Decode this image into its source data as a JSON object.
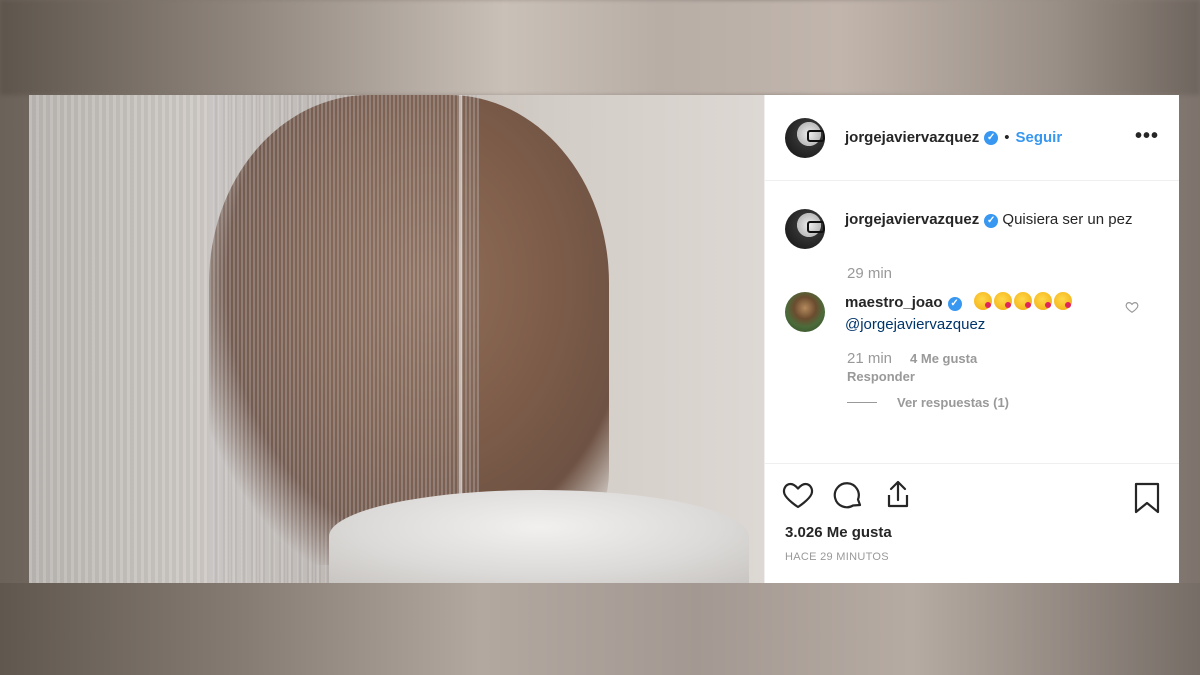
{
  "post": {
    "author": {
      "username": "jorgejavier vazquez",
      "display_username": "jorgejaviervazquez",
      "verified": true
    },
    "header": {
      "separator": "•",
      "follow_label": "Seguir",
      "more_label": "•••"
    },
    "caption": {
      "username": "jorgejaviervazquez",
      "text": "Quisiera ser un pez",
      "time": "29 min"
    },
    "comments": [
      {
        "username": "maestro_joao",
        "verified": true,
        "emoji_count": 5,
        "mention": "@jorgejaviervazquez",
        "time": "21 min",
        "likes": "4 Me gusta",
        "reply_label": "Responder",
        "view_replies_label": "Ver respuestas (1)"
      }
    ],
    "likes_text": "3.026 Me gusta",
    "timestamp": "HACE 29 MINUTOS"
  },
  "icons": {
    "heart": "heart-icon",
    "comment": "comment-icon",
    "share": "share-icon",
    "bookmark": "bookmark-icon",
    "verified": "verified-icon"
  },
  "colors": {
    "link_blue": "#3897f0",
    "text": "#262626",
    "muted": "#999999",
    "mention": "#003569"
  }
}
